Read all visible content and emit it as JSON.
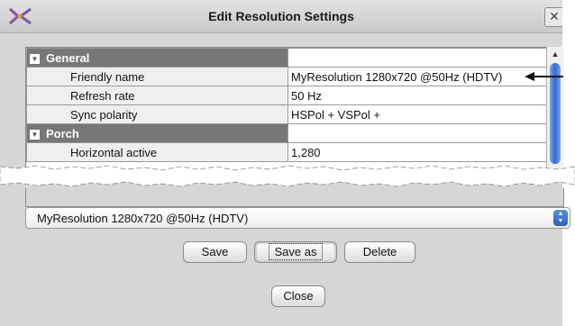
{
  "window": {
    "title": "Edit Resolution Settings",
    "app_icon": "x-logo-icon",
    "close_glyph": "✕"
  },
  "grid": {
    "sections": [
      {
        "label": "General",
        "rows": [
          {
            "name": "Friendly name",
            "value": "MyResolution 1280x720 @50Hz (HDTV)"
          },
          {
            "name": "Refresh rate",
            "value": "50 Hz"
          },
          {
            "name": "Sync polarity",
            "value": "HSPol +  VSPol +"
          }
        ]
      },
      {
        "label": "Porch",
        "rows": [
          {
            "name": "Horizontal active",
            "value": "1,280"
          }
        ]
      }
    ]
  },
  "resolution_select": {
    "value": "MyResolution 1280x720 @50Hz (HDTV)"
  },
  "buttons": {
    "save": "Save",
    "save_as": "Save as",
    "delete": "Delete",
    "close": "Close"
  },
  "colors": {
    "section_header": "#777777",
    "scroll_thumb": "#2f6bd0",
    "dialog_bg": "#d6d6d6"
  }
}
